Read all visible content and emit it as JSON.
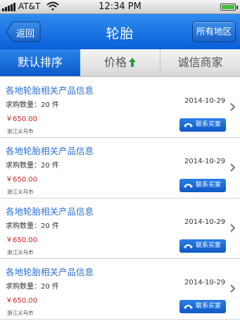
{
  "status": {
    "carrier": "AT&T",
    "time": "12:34 PM",
    "icons": [
      "signal-icon",
      "wifi-icon",
      "battery-icon"
    ]
  },
  "nav": {
    "back_label": "返回",
    "title": "轮胎",
    "region_label": "所有地区"
  },
  "tabs": [
    {
      "label": "默认排序",
      "active": true
    },
    {
      "label": "价格",
      "icon": "arrow-up-icon",
      "active": false
    },
    {
      "label": "诚信商家",
      "active": false
    }
  ],
  "items": [
    {
      "title": "各地轮胎相关产品信息",
      "qty": "求购数量：20 件",
      "date": "2014-10-29",
      "price": "￥650.00",
      "location": "浙江义乌市",
      "contact_label": "联系买家"
    },
    {
      "title": "各地轮胎相关产品信息",
      "qty": "求购数量：20 件",
      "date": "2014-10-29",
      "price": "￥650.00",
      "location": "浙江义乌市",
      "contact_label": "联系买家"
    },
    {
      "title": "各地轮胎相关产品信息",
      "qty": "求购数量：20 件",
      "date": "2014-10-29",
      "price": "￥650.00",
      "location": "浙江义乌市",
      "contact_label": "联系买家"
    },
    {
      "title": "各地轮胎相关产品信息",
      "qty": "求购数量：20 件",
      "date": "2014-10-29",
      "price": "￥650.00",
      "location": "浙江义乌市",
      "contact_label": "联系买家"
    }
  ],
  "colors": {
    "nav_blue": "#1a6fe0",
    "title_blue": "#2a6fd6",
    "price_red": "#cc1f1f",
    "arrow_green": "#1f9e3a"
  }
}
